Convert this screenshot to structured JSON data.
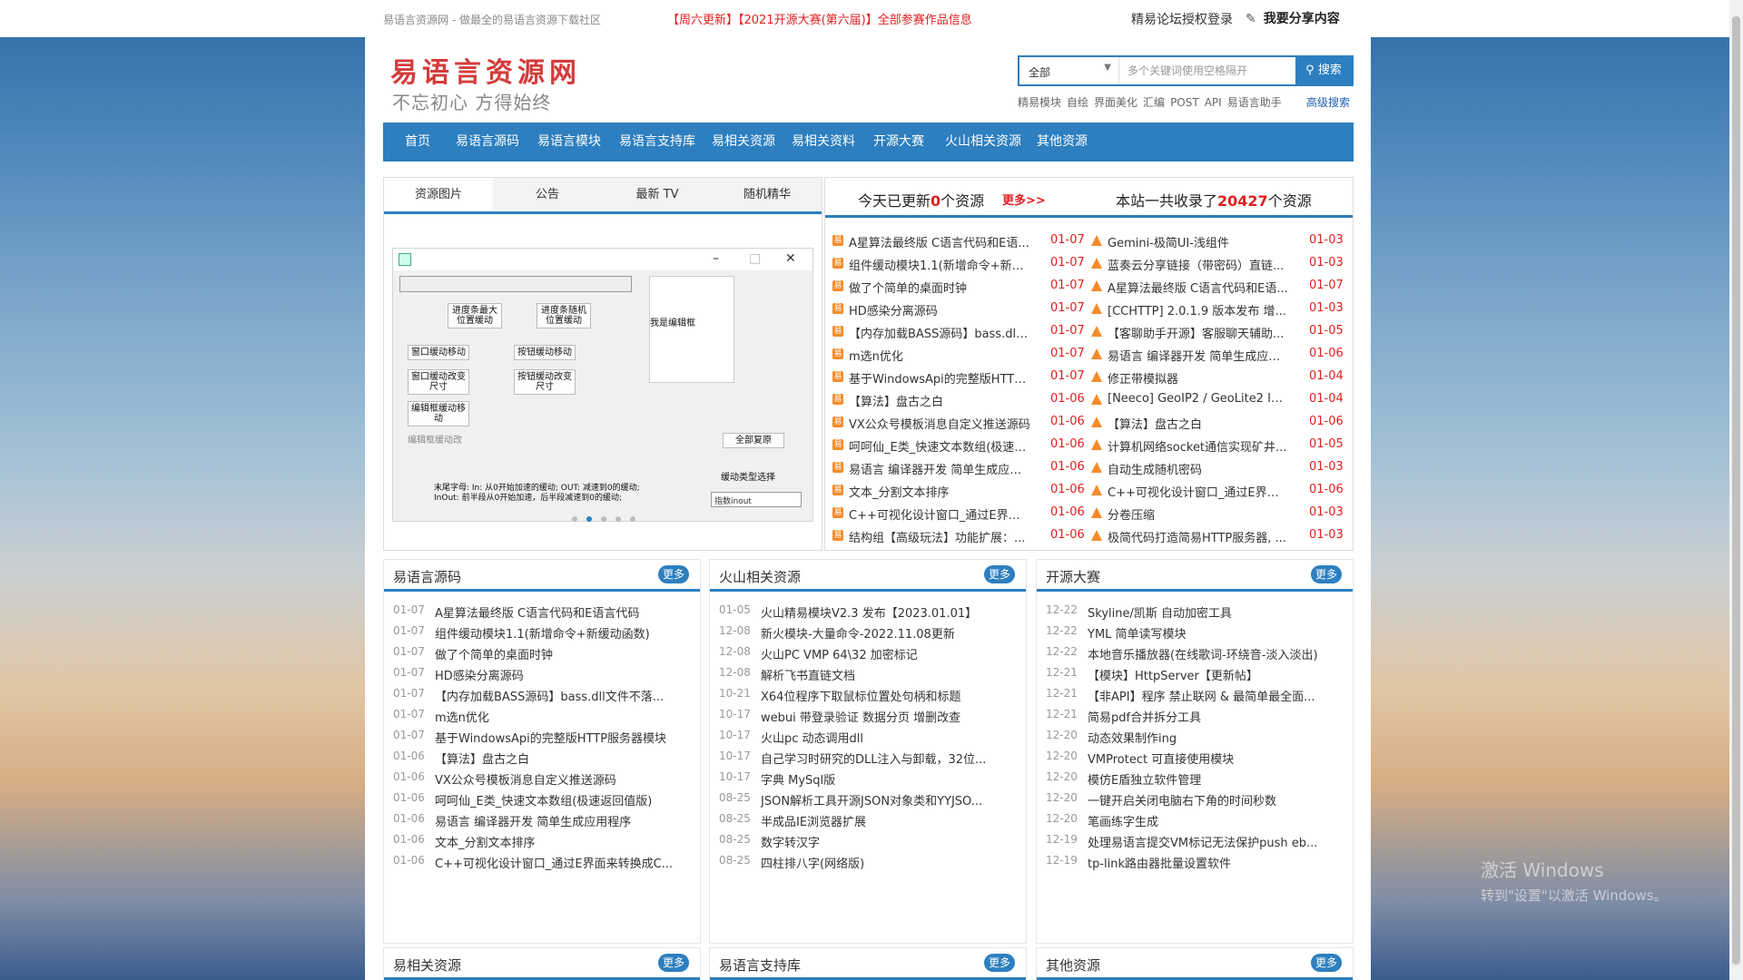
{
  "topbar": {
    "slogan": "易语言资源网 - 做最全的易语言资源下载社区",
    "notice": "【周六更新】【2021开源大赛(第六届)】全部参赛作品信息",
    "login": "精易论坛授权登录",
    "share": "我要分享内容"
  },
  "header": {
    "logo": "易语言资源网",
    "logo_sub": "不忘初心 方得始终"
  },
  "search": {
    "category": "全部",
    "placeholder": "多个关键词使用空格隔开",
    "button": "搜索",
    "hot": [
      "精易模块",
      "自绘",
      "界面美化",
      "汇编",
      "POST",
      "API",
      "易语言助手"
    ],
    "advanced": "高级搜索"
  },
  "nav": [
    "首页",
    "易语言源码",
    "易语言模块",
    "易语言支持库",
    "易相关资源",
    "易相关资料",
    "开源大赛",
    "火山相关资源",
    "其他资源"
  ],
  "tabs": [
    "资源图片",
    "公告",
    "最新 TV",
    "随机精华"
  ],
  "slide": {
    "buttons": [
      "进度条最大位置缓动",
      "进度条随机位置缓动",
      "窗口缓动移动",
      "按钮缓动移动",
      "窗口缓动改变尺寸",
      "按钮缓动改变尺寸",
      "编辑框缓动移动",
      "编辑框缓动改",
      "全部复原"
    ],
    "edit_label": "我是编辑框",
    "type_label": "缓动类型选择",
    "combo": "指数inout",
    "desc1": "末尾字母: In: 从0开始加速的缓动; OUT: 减速到0的缓动;",
    "desc2": "InOut: 前半段从0开始加速，后半段减速到0的缓动;"
  },
  "news": {
    "today_pre": "今天已更新",
    "today_count": "0",
    "today_post": "个资源",
    "more": "更多>>",
    "total_pre": "本站一共收录了",
    "total_count": "20427",
    "total_post": "个资源",
    "left": [
      {
        "t": "A星算法最终版 C语言代码和E语...",
        "d": "01-07"
      },
      {
        "t": "组件缓动模块1.1(新增命令+新缓...",
        "d": "01-07"
      },
      {
        "t": "做了个简单的桌面时钟",
        "d": "01-07"
      },
      {
        "t": "HD感染分离源码",
        "d": "01-07"
      },
      {
        "t": "【内存加载BASS源码】bass.dll...",
        "d": "01-07"
      },
      {
        "t": "m选n优化",
        "d": "01-07"
      },
      {
        "t": "基于WindowsApi的完整版HTTP...",
        "d": "01-07"
      },
      {
        "t": "【算法】盘古之白",
        "d": "01-06"
      },
      {
        "t": "VX公众号模板消息自定义推送源码",
        "d": "01-06"
      },
      {
        "t": "呵呵仙_E类_快速文本数组(极速返...",
        "d": "01-06"
      },
      {
        "t": "易语言 编译器开发 简单生成应用...",
        "d": "01-06"
      },
      {
        "t": "文本_分割文本排序",
        "d": "01-06"
      },
      {
        "t": "C++可视化设计窗口_通过E界面...",
        "d": "01-06"
      },
      {
        "t": "结构组【高级玩法】功能扩展：...",
        "d": "01-06"
      }
    ],
    "right": [
      {
        "t": "Gemini-极简UI-浅组件",
        "d": "01-03"
      },
      {
        "t": "蓝奏云分享链接（带密码）直链...",
        "d": "01-03"
      },
      {
        "t": "A星算法最终版 C语言代码和E语...",
        "d": "01-07"
      },
      {
        "t": "[CCHTTP] 2.0.1.9 版本发布 增...",
        "d": "01-03"
      },
      {
        "t": "【客聊助手开源】客服聊天辅助...",
        "d": "01-05"
      },
      {
        "t": "易语言 编译器开发 简单生成应用...",
        "d": "01-06"
      },
      {
        "t": "修正带模拟器",
        "d": "01-04"
      },
      {
        "t": "[Neeco] GeoIP2 / GeoLite2 IPV...",
        "d": "01-04"
      },
      {
        "t": "【算法】盘古之白",
        "d": "01-06"
      },
      {
        "t": "计算机网络socket通信实现矿井...",
        "d": "01-05"
      },
      {
        "t": "自动生成随机密码",
        "d": "01-03"
      },
      {
        "t": "C++可视化设计窗口_通过E界面...",
        "d": "01-06"
      },
      {
        "t": "分卷压缩",
        "d": "01-03"
      },
      {
        "t": "极简代码打造简易HTTP服务器, ...",
        "d": "01-03"
      }
    ]
  },
  "panels": [
    {
      "title": "易语言源码",
      "more": "更多",
      "rows": [
        {
          "d": "01-07",
          "t": "A星算法最终版 C语言代码和E语言代码"
        },
        {
          "d": "01-07",
          "t": "组件缓动模块1.1(新增命令+新缓动函数)"
        },
        {
          "d": "01-07",
          "t": "做了个简单的桌面时钟"
        },
        {
          "d": "01-07",
          "t": "HD感染分离源码"
        },
        {
          "d": "01-07",
          "t": "【内存加载BASS源码】bass.dll文件不落..."
        },
        {
          "d": "01-07",
          "t": "m选n优化"
        },
        {
          "d": "01-07",
          "t": "基于WindowsApi的完整版HTTP服务器模块"
        },
        {
          "d": "01-06",
          "t": "【算法】盘古之白"
        },
        {
          "d": "01-06",
          "t": "VX公众号模板消息自定义推送源码"
        },
        {
          "d": "01-06",
          "t": "呵呵仙_E类_快速文本数组(极速返回值版)"
        },
        {
          "d": "01-06",
          "t": "易语言 编译器开发 简单生成应用程序"
        },
        {
          "d": "01-06",
          "t": "文本_分割文本排序"
        },
        {
          "d": "01-06",
          "t": "C++可视化设计窗口_通过E界面来转换成C..."
        }
      ]
    },
    {
      "title": "火山相关资源",
      "more": "更多",
      "rows": [
        {
          "d": "01-05",
          "t": "火山精易模块V2.3 发布【2023.01.01】"
        },
        {
          "d": "12-08",
          "t": "新火模块-大量命令-2022.11.08更新"
        },
        {
          "d": "12-08",
          "t": "火山PC VMP 64\\32 加密标记"
        },
        {
          "d": "12-08",
          "t": "解析飞书直链文档"
        },
        {
          "d": "10-21",
          "t": "X64位程序下取鼠标位置处句柄和标题"
        },
        {
          "d": "10-17",
          "t": "webui 带登录验证 数据分页 增删改查"
        },
        {
          "d": "10-17",
          "t": "火山pc 动态调用dll"
        },
        {
          "d": "10-17",
          "t": "自己学习时研究的DLL注入与卸载，32位..."
        },
        {
          "d": "10-17",
          "t": "字典 MySql版"
        },
        {
          "d": "08-25",
          "t": "JSON解析工具开源JSON对象类和YYJSO..."
        },
        {
          "d": "08-25",
          "t": "半成品IE浏览器扩展"
        },
        {
          "d": "08-25",
          "t": "数字转汉字"
        },
        {
          "d": "08-25",
          "t": "四柱排八字(网络版)"
        }
      ]
    },
    {
      "title": "开源大赛",
      "more": "更多",
      "rows": [
        {
          "d": "12-22",
          "t": "Skyline/凯斯 自动加密工具"
        },
        {
          "d": "12-22",
          "t": "YML 简单读写模块"
        },
        {
          "d": "12-22",
          "t": "本地音乐播放器(在线歌词-环绕音-淡入淡出)"
        },
        {
          "d": "12-21",
          "t": "【模块】HttpServer【更新帖】"
        },
        {
          "d": "12-21",
          "t": "【非API】程序 禁止联网 & 最简单最全面..."
        },
        {
          "d": "12-21",
          "t": "简易pdf合并拆分工具"
        },
        {
          "d": "12-20",
          "t": "动态效果制作ing"
        },
        {
          "d": "12-20",
          "t": "VMProtect 可直接使用模块"
        },
        {
          "d": "12-20",
          "t": "模仿E盾独立软件管理"
        },
        {
          "d": "12-20",
          "t": "一键开启关闭电脑右下角的时间秒数"
        },
        {
          "d": "12-20",
          "t": "笔画练字生成"
        },
        {
          "d": "12-19",
          "t": "处理易语言提交VM标记无法保护push eb..."
        },
        {
          "d": "12-19",
          "t": "tp-link路由器批量设置软件"
        }
      ]
    }
  ],
  "bottom_panels": [
    {
      "title": "易相关资源",
      "more": "更多"
    },
    {
      "title": "易语言支持库",
      "more": "更多"
    },
    {
      "title": "其他资源",
      "more": "更多"
    }
  ],
  "watermark": {
    "line1": "激活 Windows",
    "line2": "转到\"设置\"以激活 Windows。"
  },
  "colors": {
    "primary": "#2d7fbf",
    "accent_red": "#e02020",
    "logo_red": "#d43c3c",
    "icon_orange": "#f58b2a"
  }
}
